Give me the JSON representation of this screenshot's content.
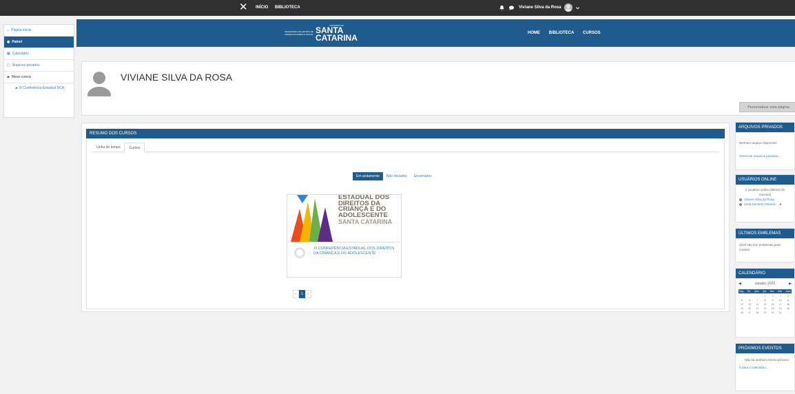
{
  "topbar": {
    "close_glyph": "✕",
    "links": [
      "INÍCIO",
      "BIBLIOTECA"
    ],
    "user_name": "Viviane Silva da Rosa"
  },
  "sidebar": {
    "items": [
      {
        "label": "Página inicial",
        "icon": "home-icon"
      },
      {
        "label": "Painel",
        "icon": "dashboard-icon"
      },
      {
        "label": "Calendário",
        "icon": "calendar-icon"
      },
      {
        "label": "Arquivos privados",
        "icon": "file-icon"
      },
      {
        "label": "Meus cursos",
        "icon": "graduation-cap-icon"
      }
    ],
    "sub_item": "XI Conferência Estadual DCA"
  },
  "banner": {
    "gov_label": "GOVERNO DE",
    "secretaria": "SECRETARIA DE ESTADO DE DESENVOLVIMENTO SOCIAL",
    "brand_line1": "SANTA",
    "brand_line2": "CATARINA",
    "nav": [
      "HOME",
      "BIBLIOTECA",
      "CURSOS"
    ]
  },
  "profile": {
    "name": "VIVIANE SILVA DA ROSA",
    "customize_label": "Personalizar esta página"
  },
  "courses": {
    "title": "RESUMO DOS CURSOS",
    "tabs": [
      "Linha do tempo",
      "Cursos"
    ],
    "filters": [
      "Em andamento",
      "Não iniciados",
      "Encerrados"
    ],
    "card": {
      "img_title": "ESTADUAL DOS DIREITOS DA CRIANÇA E DO ADOLESCENTE",
      "img_subtitle": "SANTA CATARINA",
      "course_title": "XI CONFERÊNCIA ESTADUAL DOS DIREITOS DA CRIANÇA E DO ADOLESCENTE"
    },
    "pager": [
      "«",
      "1",
      "»"
    ]
  },
  "right": {
    "files": {
      "title": "ARQUIVOS PRIVADOS",
      "empty": "Nenhum arquivo disponível",
      "manage": "Gerenciar arquivos privados..."
    },
    "online": {
      "title": "USUÁRIOS ONLINE",
      "summary": "2 usuários online (últimos 20 minutos)",
      "users": [
        "Viviane Silva da Rosa",
        "Cleia Demetrio Pereira"
      ]
    },
    "badges": {
      "title": "ÚLTIMOS EMBLEMAS",
      "text": "Você não tem emblemas para mostrar"
    },
    "calendar": {
      "title": "CALENDÁRIO",
      "month": "outubro 2020",
      "weekdays": [
        "Seg",
        "Ter",
        "Qua",
        "Qui",
        "Sex",
        "Sáb",
        "Dom"
      ],
      "weeks": [
        [
          "",
          "",
          "",
          "1",
          "2",
          "3",
          "4"
        ],
        [
          "5",
          "6",
          "7",
          "8",
          "9",
          "10",
          "11"
        ],
        [
          "12",
          "13",
          "14",
          "15",
          "16",
          "17",
          "18"
        ],
        [
          "19",
          "20",
          "21",
          "22",
          "23",
          "24",
          "25"
        ],
        [
          "26",
          "27",
          "28",
          "29",
          "30",
          "31",
          ""
        ]
      ]
    },
    "events": {
      "title": "PRÓXIMOS EVENTOS",
      "text": "Não há nenhum evento próximo",
      "link": "Ir para o calendário..."
    }
  }
}
